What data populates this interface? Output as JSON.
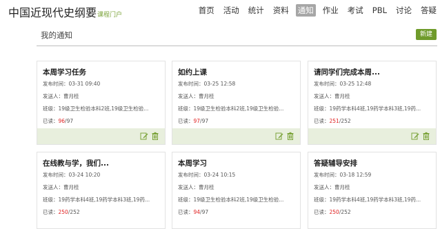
{
  "brand": {
    "title": "中国近现代史纲要",
    "subtitle": "课程门户"
  },
  "nav": [
    {
      "label": "首页",
      "active": false
    },
    {
      "label": "活动",
      "active": false
    },
    {
      "label": "统计",
      "active": false
    },
    {
      "label": "资料",
      "active": false
    },
    {
      "label": "通知",
      "active": true
    },
    {
      "label": "作业",
      "active": false
    },
    {
      "label": "考试",
      "active": false
    },
    {
      "label": "PBL",
      "active": false
    },
    {
      "label": "讨论",
      "active": false
    },
    {
      "label": "答疑",
      "active": false
    }
  ],
  "section": {
    "title": "我的通知",
    "new_label": "新建"
  },
  "cards": [
    {
      "title": "本周学习任务",
      "time": "发布时间：03-31 09:40",
      "sender": "发送人：曹月桂",
      "classes": "班级：19级卫生检验本科2班,19级卫生检验...",
      "read_prefix": "已读：",
      "read": "96",
      "total": "/97"
    },
    {
      "title": "如约上课",
      "time": "发布时间：03-25 12:58",
      "sender": "发送人：曹月桂",
      "classes": "班级：19级卫生检验本科2班,19级卫生检验...",
      "read_prefix": "已读：",
      "read": "97",
      "total": "/97"
    },
    {
      "title": "请同学们完成本周...",
      "time": "发布时间：03-25 12:48",
      "sender": "发送人：曹月桂",
      "classes": "班级：19药学本科4班,19药学本科3班,19药...",
      "read_prefix": "已读：",
      "read": "251",
      "total": "/252"
    },
    {
      "title": "在线教与学，我们...",
      "time": "发布时间：03-24 10:20",
      "sender": "发送人：曹月桂",
      "classes": "班级：19药学本科4班,19药学本科3班,19药...",
      "read_prefix": "已读：",
      "read": "250",
      "total": "/252"
    },
    {
      "title": "本周学习",
      "time": "发布时间：03-24 10:15",
      "sender": "发送人：曹月桂",
      "classes": "班级：19级卫生检验本科2班,19级卫生检验...",
      "read_prefix": "已读：",
      "read": "94",
      "total": "/97"
    },
    {
      "title": "答疑辅导安排",
      "time": "发布时间：03-18 12:59",
      "sender": "发送人：曹月桂",
      "classes": "班级：19药学本科4班,19药学本科3班,19药...",
      "read_prefix": "已读：",
      "read": "250",
      "total": "/252"
    }
  ],
  "colors": {
    "accent": "#6f9b2b",
    "footer_bg": "#e8efdd",
    "read_red": "#e02020",
    "active_tab": "#a6a6a6"
  },
  "icons": {
    "edit": "edit-icon",
    "delete": "trash-icon"
  }
}
